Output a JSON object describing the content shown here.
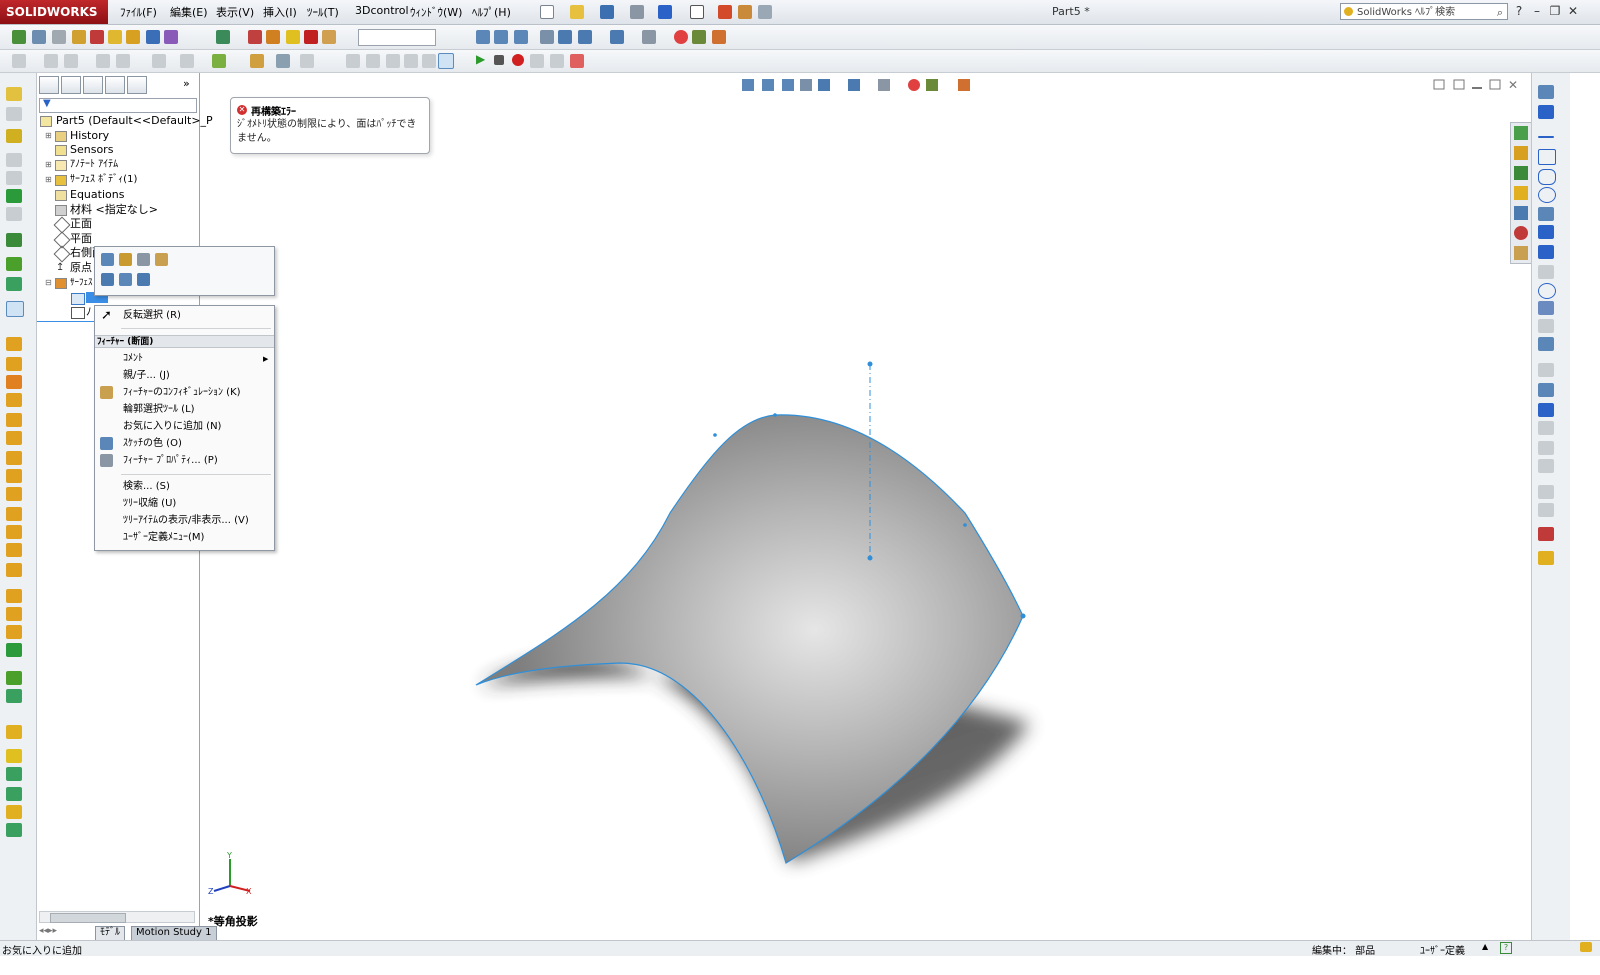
{
  "app": {
    "brand": "SOLIDWORKS",
    "doc_title": "Part5 *",
    "help_search_placeholder": "SolidWorks ﾍﾙﾌﾟ検索"
  },
  "menubar": [
    "ﾌｧｲﾙ(F)",
    "編集(E)",
    "表示(V)",
    "挿入(I)",
    "ﾂｰﾙ(T)",
    "3Dcontrol",
    "ｳｨﾝﾄﾞｳ(W)",
    "ﾍﾙﾌﾟ(H)"
  ],
  "error_bubble": {
    "title": "再構築ｴﾗｰ",
    "body": "ｼﾞｵﾒﾄﾘ状態の制限により、面はﾊﾟｯﾁできません。"
  },
  "tree": {
    "root": "Part5  (Default<<Default>_P",
    "items": [
      "History",
      "Sensors",
      "ｱﾉﾃｰﾄ ｱｲﾃﾑ",
      "ｻｰﾌｪｽ ﾎﾞﾃﾞｨ(1)",
      "Equations",
      "材料 <指定なし>",
      "正面",
      "平面",
      "右側面",
      "原点",
      "ｻｰﾌｪｽ",
      "ﾉ"
    ]
  },
  "context_menu": {
    "top_item": "反転選択 (R)",
    "header": "ﾌｨｰﾁｬｰ (断面)",
    "items": [
      "ｺﾒﾝﾄ",
      "親/子... (J)",
      "ﾌｨｰﾁｬｰのｺﾝﾌｨｷﾞｭﾚｰｼｮﾝ (K)",
      "輪郭選択ﾂｰﾙ (L)",
      "お気に入りに追加 (N)",
      "ｽｹｯﾁの色 (O)",
      "ﾌｨｰﾁｬｰ ﾌﾟﾛﾊﾟﾃｨ... (P)",
      "検索... (S)",
      "ﾂﾘｰ収縮 (U)",
      "ﾂﾘｰｱｲﾃﾑの表示/非表示... (V)",
      "ﾕｰｻﾞｰ定義ﾒﾆｭｰ(M)"
    ]
  },
  "view": {
    "label": "*等角投影"
  },
  "bottom_tabs": [
    "ﾓﾃﾞﾙ",
    "Motion Study 1"
  ],
  "status": {
    "left": "お気に入りに追加",
    "mode": "編集中： 部品",
    "units": "ﾕｰｻﾞｰ定義"
  },
  "colors": {
    "accent": "#2f8fd8",
    "title_red": "#b3181d",
    "error": "#d23030"
  }
}
